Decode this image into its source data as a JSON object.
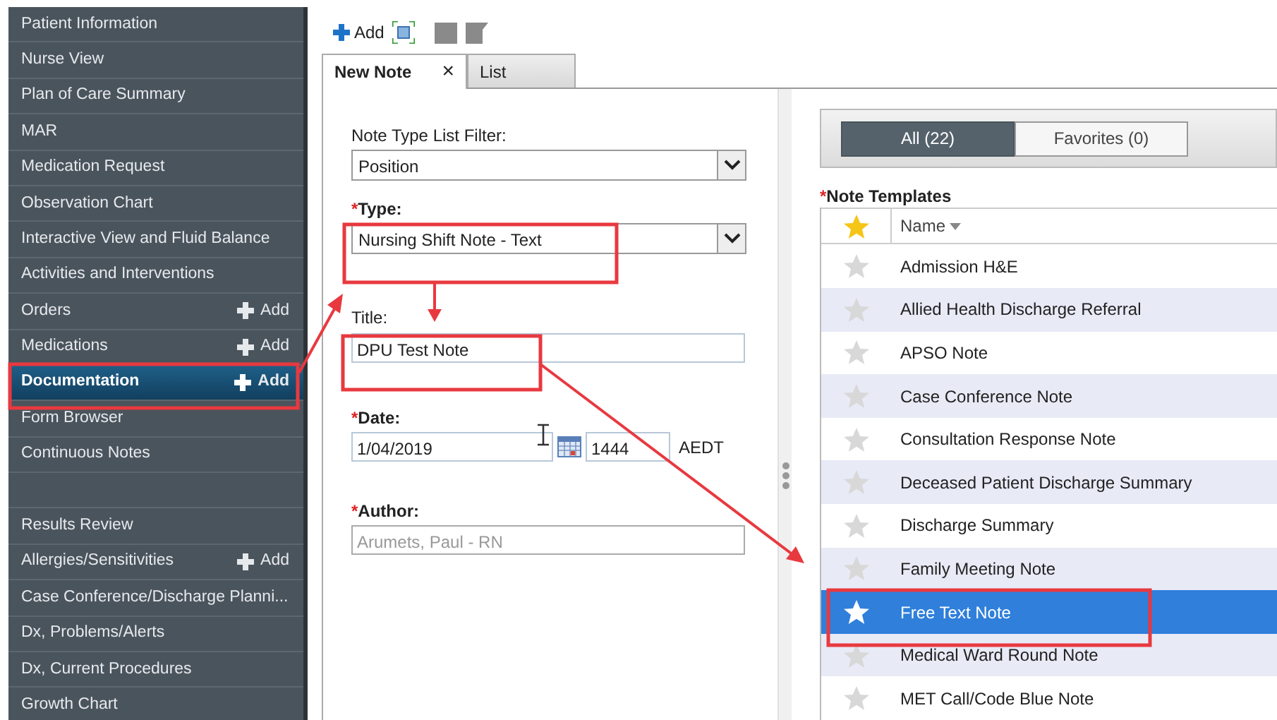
{
  "sidebar": {
    "groups": [
      {
        "items": [
          {
            "label": "Patient Information",
            "selected": false
          },
          {
            "label": "Nurse View",
            "selected": false
          },
          {
            "label": "Plan of Care Summary",
            "selected": false
          },
          {
            "label": "MAR",
            "selected": false
          },
          {
            "label": "Medication Request",
            "selected": false
          },
          {
            "label": "Observation Chart",
            "selected": false
          },
          {
            "label": "Interactive View and Fluid Balance",
            "selected": false
          },
          {
            "label": "Activities and Interventions",
            "selected": false
          },
          {
            "label": "Orders",
            "add": "Add",
            "selected": false
          },
          {
            "label": "Medications",
            "add": "Add",
            "selected": false
          },
          {
            "label": "Documentation",
            "add": "Add",
            "selected": true
          },
          {
            "label": "Form Browser",
            "selected": false
          },
          {
            "label": "Continuous Notes",
            "selected": false
          }
        ]
      },
      {
        "items": [
          {
            "label": "Results Review",
            "selected": false
          },
          {
            "label": "Allergies/Sensitivities",
            "add": "Add",
            "selected": false
          },
          {
            "label": "Case Conference/Discharge Planni...",
            "selected": false
          },
          {
            "label": "Dx, Problems/Alerts",
            "selected": false
          },
          {
            "label": "Dx, Current Procedures",
            "selected": false
          },
          {
            "label": "Growth Chart",
            "selected": false
          }
        ]
      }
    ]
  },
  "toolbar": {
    "add_label": "Add"
  },
  "tabs": [
    {
      "label": "New Note",
      "selected": true,
      "close": "×"
    },
    {
      "label": "List",
      "selected": false
    }
  ],
  "form": {
    "filter": {
      "label": "Note Type List Filter:",
      "value": "Position"
    },
    "type": {
      "mark": "*",
      "label": "Type:",
      "value": "Nursing Shift Note - Text"
    },
    "title": {
      "label": "Title:",
      "value": "DPU Test Note"
    },
    "date": {
      "mark": "*",
      "label": "Date:",
      "value": "1/04/2019",
      "time": "1444",
      "zone": "AEDT"
    },
    "author": {
      "mark": "*",
      "label": "Author:",
      "value": "Arumets, Paul  - RN",
      "disabled": true
    }
  },
  "filters": [
    {
      "label": "All (22)",
      "selected": true
    },
    {
      "label": "Favorites (0)",
      "selected": false
    }
  ],
  "templates": {
    "mark": "*",
    "title": "Note Templates",
    "column": "Name",
    "rows": [
      {
        "name": "Admission H&E",
        "favorite": false,
        "selected": false
      },
      {
        "name": "Allied Health Discharge Referral",
        "favorite": false,
        "selected": false
      },
      {
        "name": "APSO Note",
        "favorite": false,
        "selected": false
      },
      {
        "name": "Case Conference Note",
        "favorite": false,
        "selected": false
      },
      {
        "name": "Consultation Response Note",
        "favorite": false,
        "selected": false
      },
      {
        "name": "Deceased Patient Discharge Summary",
        "favorite": false,
        "selected": false
      },
      {
        "name": "Discharge Summary",
        "favorite": false,
        "selected": false
      },
      {
        "name": "Family Meeting Note",
        "favorite": false,
        "selected": false
      },
      {
        "name": "Free Text Note",
        "favorite": false,
        "selected": true
      },
      {
        "name": "Medical Ward Round Note",
        "favorite": false,
        "selected": false
      },
      {
        "name": "MET Call/Code Blue Note",
        "favorite": false,
        "selected": false
      }
    ]
  }
}
